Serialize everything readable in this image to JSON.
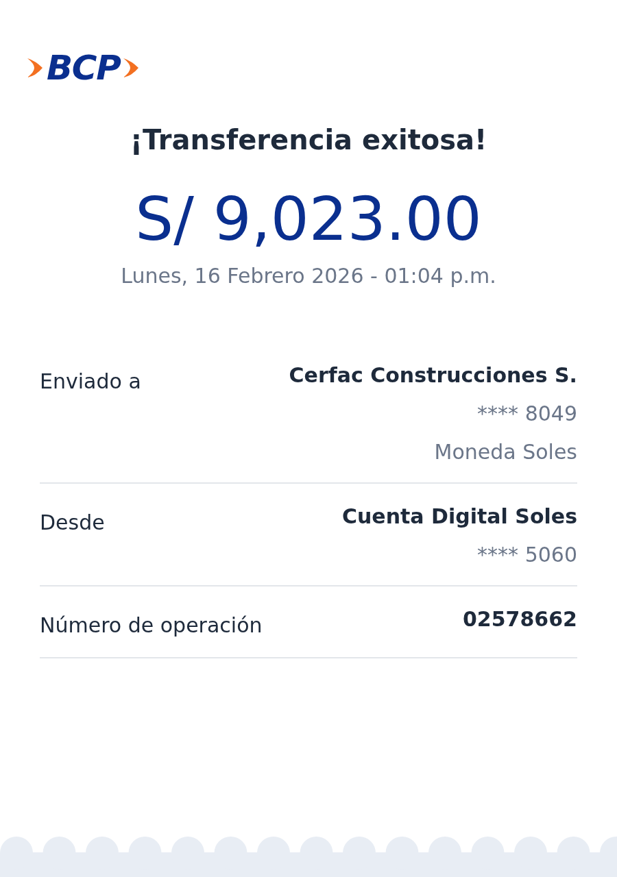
{
  "logo": {
    "text": "BCP"
  },
  "title": "¡Transferencia exitosa!",
  "amount": "S/ 9,023.00",
  "datetime": "Lunes, 16 Febrero 2026 - 01:04 p.m.",
  "details": [
    {
      "label": "Enviado a",
      "lines": [
        {
          "kind": "primary",
          "text": "Cerfac Construcciones S."
        },
        {
          "kind": "secondary",
          "text": "**** 8049"
        },
        {
          "kind": "secondary",
          "text": "Moneda Soles"
        }
      ]
    },
    {
      "label": "Desde",
      "lines": [
        {
          "kind": "primary",
          "text": "Cuenta Digital Soles"
        },
        {
          "kind": "secondary",
          "text": "**** 5060"
        }
      ]
    },
    {
      "label": "Número de operación",
      "lines": [
        {
          "kind": "primary",
          "text": "02578662"
        }
      ]
    }
  ]
}
